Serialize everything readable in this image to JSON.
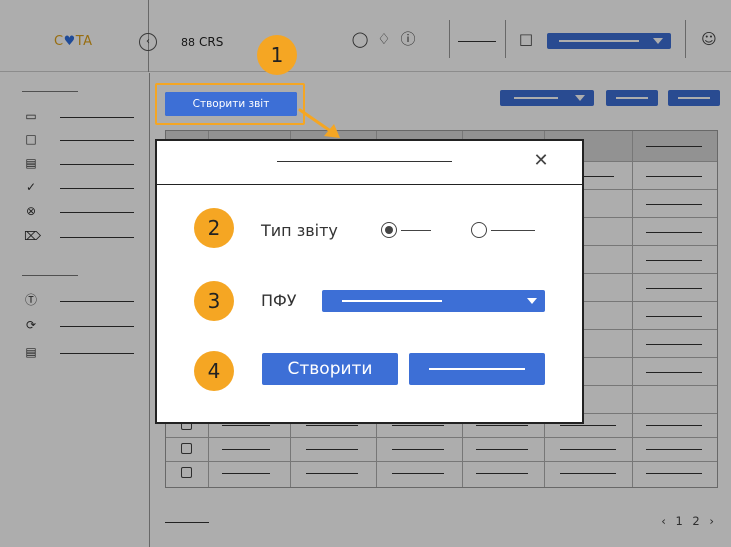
{
  "header": {
    "logo_prefix": "C",
    "logo_heart": "♥",
    "logo_suffix": "TA",
    "app_name": "CRS",
    "grid_icon": "88"
  },
  "toolbar": {
    "create_report_label": "Створити звіт"
  },
  "pagination": {
    "text": "‹ 1 2 ›"
  },
  "callouts": [
    "1",
    "2",
    "3",
    "4"
  ],
  "modal": {
    "report_type_label": "Тип звіту",
    "report_type_selected": "first",
    "pfu_label": "ПФУ",
    "create_label": "Створити"
  },
  "colors": {
    "accent": "#3d6fd6",
    "callout": "#f5a623",
    "logo": "#e0a21a"
  }
}
